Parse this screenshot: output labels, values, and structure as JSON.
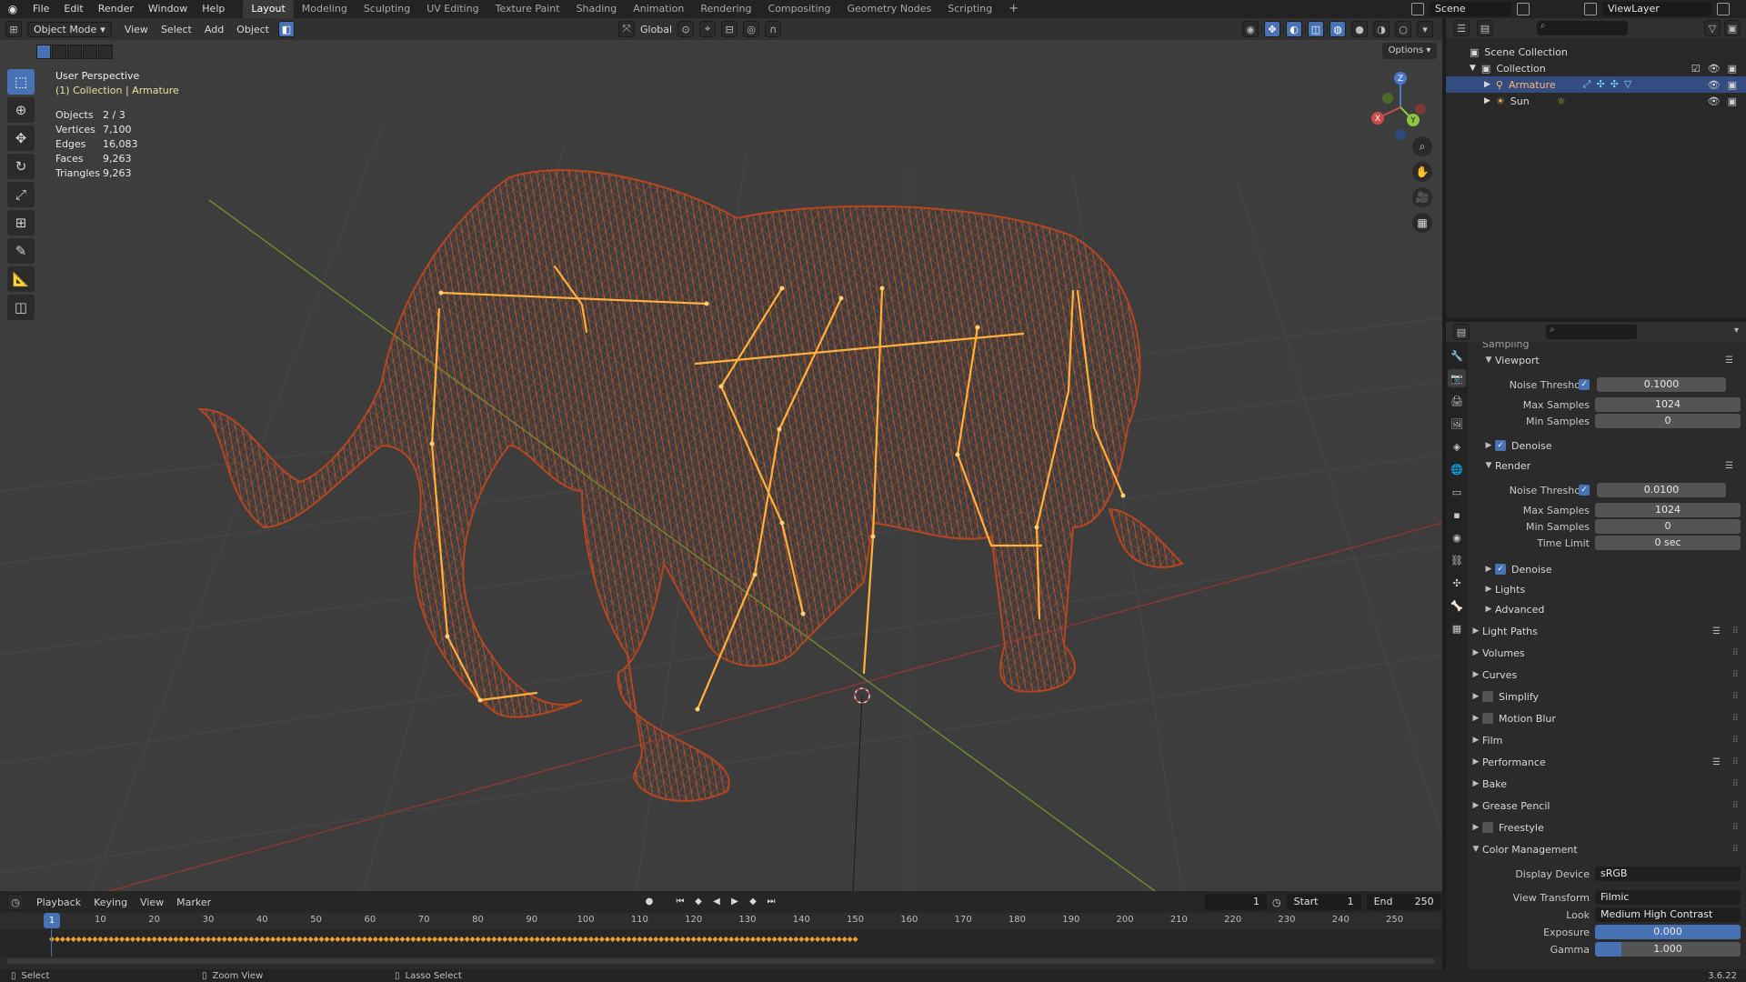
{
  "topbar": {
    "menu": [
      "File",
      "Edit",
      "Render",
      "Window",
      "Help"
    ],
    "workspaces": [
      "Layout",
      "Modeling",
      "Sculpting",
      "UV Editing",
      "Texture Paint",
      "Shading",
      "Animation",
      "Rendering",
      "Compositing",
      "Geometry Nodes",
      "Scripting"
    ],
    "active_workspace": "Layout",
    "add_workspace": "+",
    "scene": "Scene",
    "view_layer": "ViewLayer"
  },
  "viewport": {
    "mode": "Object Mode",
    "menu": [
      "View",
      "Select",
      "Add",
      "Object"
    ],
    "orientation": "Global",
    "options": "Options",
    "perspective": "User Perspective",
    "collection_info": "(1) Collection | Armature",
    "stats": [
      {
        "label": "Objects",
        "value": "2 / 3"
      },
      {
        "label": "Vertices",
        "value": "7,100"
      },
      {
        "label": "Edges",
        "value": "16,083"
      },
      {
        "label": "Faces",
        "value": "9,263"
      },
      {
        "label": "Triangles",
        "value": "9,263"
      }
    ],
    "gizmo_axes": {
      "x": "X",
      "y": "Y",
      "z": "Z"
    },
    "colors": {
      "mesh": "#c8552a",
      "bones": "#ffb13b",
      "background": "#3d3d3d"
    }
  },
  "timeline": {
    "menu": [
      "Playback",
      "Keying",
      "View",
      "Marker"
    ],
    "current_frame": "1",
    "start_label": "Start",
    "start": "1",
    "end_label": "End",
    "end": "250",
    "ticks": [
      "1",
      "10",
      "20",
      "30",
      "40",
      "50",
      "60",
      "70",
      "80",
      "90",
      "100",
      "110",
      "120",
      "130",
      "140",
      "150",
      "160",
      "170",
      "180",
      "190",
      "200",
      "210",
      "220",
      "230",
      "240",
      "250"
    ]
  },
  "statusbar": {
    "select": "Select",
    "zoom": "Zoom View",
    "lasso": "Lasso Select",
    "version": "3.6.22"
  },
  "outliner": {
    "scene_collection": "Scene Collection",
    "collection": "Collection",
    "items": [
      {
        "name": "Armature",
        "selected": true
      },
      {
        "name": "Sun",
        "selected": false
      }
    ]
  },
  "properties": {
    "sampling_label": "Sampling",
    "viewport_section": "Viewport",
    "viewport": {
      "noise_threshold_label": "Noise Threshold",
      "noise_threshold": "0.1000",
      "max_samples_label": "Max Samples",
      "max_samples": "1024",
      "min_samples_label": "Min Samples",
      "min_samples": "0",
      "denoise": "Denoise"
    },
    "render_section": "Render",
    "render": {
      "noise_threshold_label": "Noise Threshold",
      "noise_threshold": "0.0100",
      "max_samples_label": "Max Samples",
      "max_samples": "1024",
      "min_samples_label": "Min Samples",
      "min_samples": "0",
      "time_limit_label": "Time Limit",
      "time_limit": "0 sec",
      "denoise": "Denoise"
    },
    "lights": "Lights",
    "advanced": "Advanced",
    "sections": [
      "Light Paths",
      "Volumes",
      "Curves",
      "Simplify",
      "Motion Blur",
      "Film",
      "Performance",
      "Bake",
      "Grease Pencil",
      "Freestyle"
    ],
    "color_management": "Color Management",
    "cm": {
      "display_device_label": "Display Device",
      "display_device": "sRGB",
      "view_transform_label": "View Transform",
      "view_transform": "Filmic",
      "look_label": "Look",
      "look": "Medium High Contrast",
      "exposure_label": "Exposure",
      "exposure": "0.000",
      "gamma_label": "Gamma",
      "gamma": "1.000"
    }
  }
}
